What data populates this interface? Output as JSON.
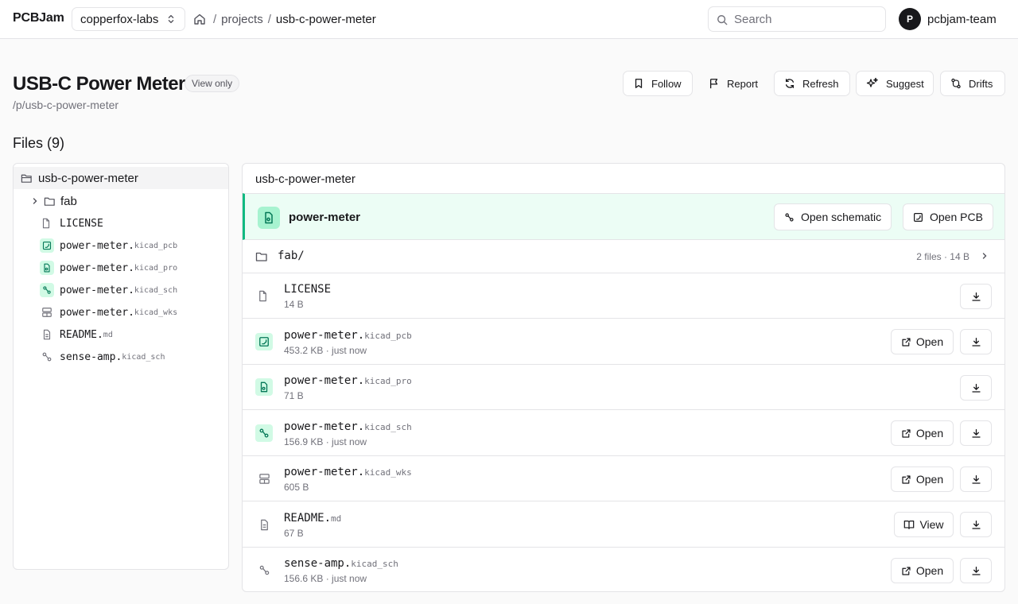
{
  "app": {
    "brand": "PCBJam"
  },
  "header": {
    "org": "copperfox-labs",
    "breadcrumb": {
      "sep1": "/",
      "projects": "projects",
      "sep2": "/",
      "current": "usb-c-power-meter"
    },
    "search_placeholder": "Search",
    "user": {
      "initial": "P",
      "name": "pcbjam-team"
    }
  },
  "project": {
    "title": "USB-C Power Meter",
    "badge": "View only",
    "slug": "/p/usb-c-power-meter",
    "actions": {
      "follow": "Follow",
      "report": "Report",
      "refresh": "Refresh",
      "suggest": "Suggest",
      "drifts": "Drifts"
    }
  },
  "files_heading": "Files (9)",
  "tree": {
    "root": "usb-c-power-meter",
    "items": [
      {
        "base": "fab",
        "ext": ""
      },
      {
        "base": "LICENSE",
        "ext": ""
      },
      {
        "base": "power-meter.",
        "ext": "kicad_pcb"
      },
      {
        "base": "power-meter.",
        "ext": "kicad_pro"
      },
      {
        "base": "power-meter.",
        "ext": "kicad_sch"
      },
      {
        "base": "power-meter.",
        "ext": "kicad_wks"
      },
      {
        "base": "README.",
        "ext": "md"
      },
      {
        "base": "sense-amp.",
        "ext": "kicad_sch"
      }
    ]
  },
  "panel": {
    "path": "usb-c-power-meter",
    "project_file": "power-meter",
    "open_schematic": "Open schematic",
    "open_pcb": "Open PCB",
    "folder": {
      "name": "fab/",
      "meta": "2 files · 14 B"
    },
    "files": [
      {
        "base": "LICENSE",
        "ext": "",
        "meta": "14 B",
        "action": ""
      },
      {
        "base": "power-meter.",
        "ext": "kicad_pcb",
        "meta": "453.2 KB · just now",
        "action": "Open"
      },
      {
        "base": "power-meter.",
        "ext": "kicad_pro",
        "meta": "71 B",
        "action": ""
      },
      {
        "base": "power-meter.",
        "ext": "kicad_sch",
        "meta": "156.9 KB · just now",
        "action": "Open"
      },
      {
        "base": "power-meter.",
        "ext": "kicad_wks",
        "meta": "605 B",
        "action": "Open"
      },
      {
        "base": "README.",
        "ext": "md",
        "meta": "67 B",
        "action": "View"
      },
      {
        "base": "sense-amp.",
        "ext": "kicad_sch",
        "meta": "156.6 KB · just now",
        "action": "Open"
      }
    ]
  },
  "colors": {
    "accent": "#10b981",
    "accent_bg": "#ecfdf5",
    "icon_bg": "#d1fae5"
  }
}
